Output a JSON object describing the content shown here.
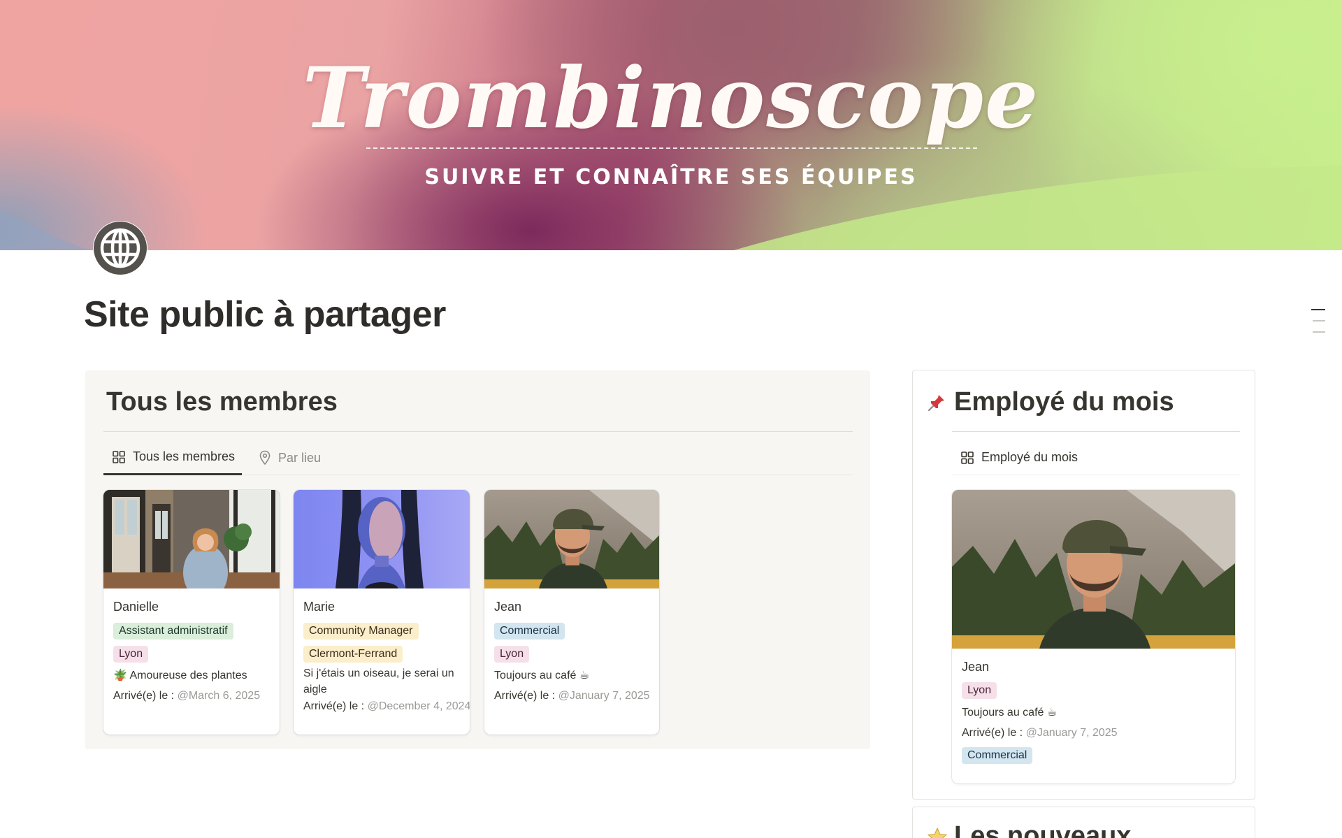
{
  "cover": {
    "title": "Trombinoscope",
    "subtitle": "SUIVRE ET CONNAÎTRE SES ÉQUIPES"
  },
  "page": {
    "icon": "globe-icon",
    "title": "Site public à partager"
  },
  "members_db": {
    "title": "Tous les membres",
    "tabs": [
      {
        "label": "Tous les membres",
        "icon": "gallery-icon",
        "active": true
      },
      {
        "label": "Par lieu",
        "icon": "map-pin-icon",
        "active": false
      }
    ],
    "cards": [
      {
        "name": "Danielle",
        "role": "Assistant administratif",
        "location": "Lyon",
        "description": "🪴 Amoureuse des plantes",
        "arrival_label": "Arrivé(e) le :",
        "arrival_date": "@March 6, 2025"
      },
      {
        "name": "Marie",
        "role": "Community Manager",
        "location": "Clermont-Ferrand",
        "description": "Si j'étais un oiseau, je serai un aigle",
        "arrival_label": "Arrivé(e) le :",
        "arrival_date": "@December 4, 2024"
      },
      {
        "name": "Jean",
        "role": "Commercial",
        "location": "Lyon",
        "description": "Toujours au café ☕",
        "arrival_label": "Arrivé(e) le :",
        "arrival_date": "@January 7, 2025"
      }
    ]
  },
  "employee_of_month": {
    "icon": "pushpin-icon",
    "title": "Employé du mois",
    "view_label": "Employé du mois",
    "card": {
      "name": "Jean",
      "location": "Lyon",
      "description": "Toujours au café ☕",
      "arrival_label": "Arrivé(e) le :",
      "arrival_date": "@January 7, 2025",
      "role": "Commercial"
    }
  },
  "newcomers": {
    "icon": "star-icon",
    "title": "Les nouveaux"
  },
  "colors": {
    "tag_green_bg": "#dbeddb",
    "tag_pink_bg": "#f5e0e9",
    "tag_yellow_bg": "#fbeecb",
    "tag_blue_bg": "#d3e5ef",
    "panel_bg": "#f7f6f3"
  }
}
